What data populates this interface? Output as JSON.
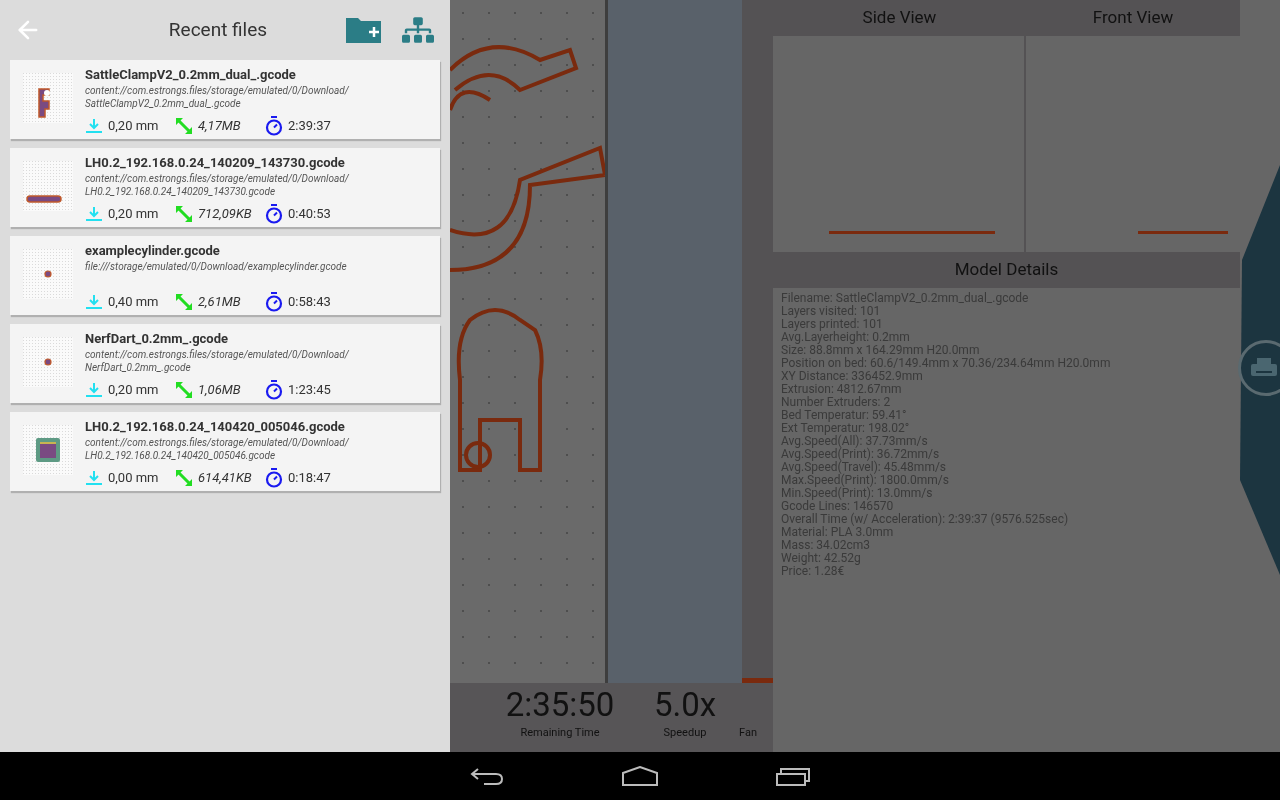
{
  "drawer": {
    "title": "Recent files"
  },
  "files": [
    {
      "name": "SattleClampV2_0.2mm_dual_.gcode",
      "path_lines": [
        "content://com.estrongs.files/storage/emulated/0/Download/",
        "SattleClampV2_0.2mm_dual_.gcode"
      ],
      "layer": "0,20 mm",
      "size": "4,17MB",
      "time": "2:39:37",
      "kind": "clamp"
    },
    {
      "name": "LH0.2_192.168.0.24_140209_143730.gcode",
      "path_lines": [
        "content://com.estrongs.files/storage/emulated/0/Download/",
        "LH0.2_192.168.0.24_140209_143730.gcode"
      ],
      "layer": "0,20 mm",
      "size": "712,09KB",
      "time": "0:40:53",
      "kind": "bar"
    },
    {
      "name": "examplecylinder.gcode",
      "path_lines": [
        "file:///storage/emulated/0/Download/examplecylinder.gcode"
      ],
      "layer": "0,40 mm",
      "size": "2,61MB",
      "time": "0:58:43",
      "kind": "dot"
    },
    {
      "name": "NerfDart_0.2mm_.gcode",
      "path_lines": [
        "content://com.estrongs.files/storage/emulated/0/Download/",
        "NerfDart_0.2mm_.gcode"
      ],
      "layer": "0,20 mm",
      "size": "1,06MB",
      "time": "1:23:45",
      "kind": "dot"
    },
    {
      "name": "LH0.2_192.168.0.24_140420_005046.gcode",
      "path_lines": [
        "content://com.estrongs.files/storage/emulated/0/Download/",
        "LH0.2_192.168.0.24_140420_005046.gcode"
      ],
      "layer": "0,00 mm",
      "size": "614,41KB",
      "time": "0:18:47",
      "kind": "square"
    }
  ],
  "status": {
    "remaining": "2:35:50",
    "remaining_label": "Remaining Time",
    "speedup": "5.0x",
    "speedup_label": "Speedup",
    "fan_label": "Fan"
  },
  "views": {
    "side": "Side View",
    "front": "Front View",
    "details_title": "Model Details"
  },
  "details": [
    {
      "label": "Filename:",
      "value": "SattleClampV2_0.2mm_dual_.gcode"
    },
    {
      "label": "Layers visited:",
      "value": "101"
    },
    {
      "label": "Layers printed:",
      "value": "101"
    },
    {
      "label": "Avg.Layerheight:",
      "value": "0.2mm"
    },
    {
      "label": "Size:",
      "value": "88.8mm x 164.29mm H20.0mm"
    },
    {
      "label": "Position on bed:",
      "value": "60.6/149.4mm x 70.36/234.64mm H20.0mm"
    },
    {
      "label": "XY Distance:",
      "value": "336452.9mm"
    },
    {
      "label": "Extrusion:",
      "value": "4812.67mm"
    },
    {
      "label": "Number Extruders:",
      "value": "2"
    },
    {
      "label": "Bed Temperatur:",
      "value": "59.41°"
    },
    {
      "label": "Ext Temperatur:",
      "value": "198.02°"
    },
    {
      "label": "Avg.Speed(All):",
      "value": "37.73mm/s"
    },
    {
      "label": "Avg.Speed(Print):",
      "value": "36.72mm/s"
    },
    {
      "label": "Avg.Speed(Travel):",
      "value": "45.48mm/s"
    },
    {
      "label": "Max.Speed(Print):",
      "value": "1800.0mm/s"
    },
    {
      "label": "Min.Speed(Print):",
      "value": "13.0mm/s"
    },
    {
      "label": "Gcode Lines:",
      "value": "146570"
    },
    {
      "label": "Overall Time (w/ Acceleration):",
      "value": "2:39:37 (9576.525sec)"
    },
    {
      "label": "Material:",
      "value": "PLA 3.0mm"
    },
    {
      "label": "Mass:",
      "value": "34.02cm3"
    },
    {
      "label": "Weight:",
      "value": "42.52g"
    },
    {
      "label": "Price:",
      "value": "1.28€"
    }
  ]
}
